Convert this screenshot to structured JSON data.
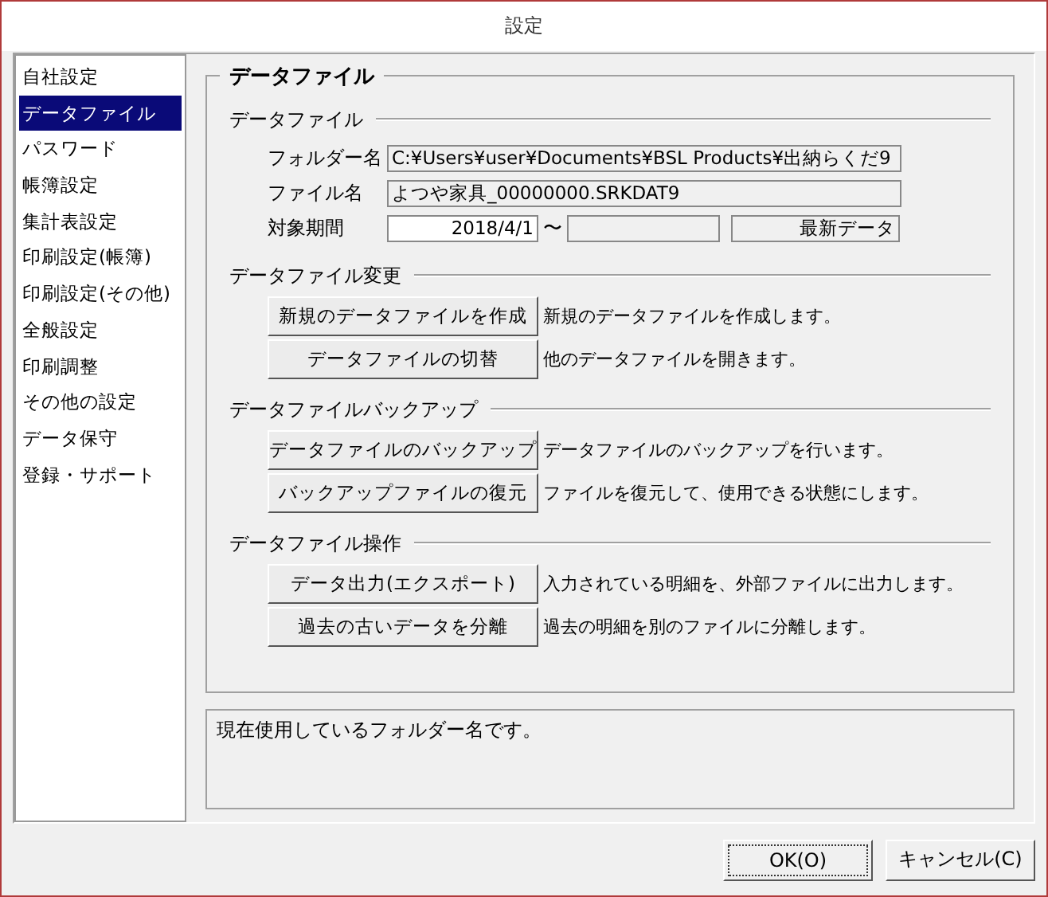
{
  "window": {
    "title": "設定"
  },
  "sidebar": {
    "items": [
      {
        "label": "自社設定",
        "selected": false
      },
      {
        "label": "データファイル",
        "selected": true
      },
      {
        "label": "パスワード",
        "selected": false
      },
      {
        "label": "帳簿設定",
        "selected": false
      },
      {
        "label": "集計表設定",
        "selected": false
      },
      {
        "label": "印刷設定(帳簿)",
        "selected": false
      },
      {
        "label": "印刷設定(その他)",
        "selected": false
      },
      {
        "label": "全般設定",
        "selected": false
      },
      {
        "label": "印刷調整",
        "selected": false
      },
      {
        "label": "その他の設定",
        "selected": false
      },
      {
        "label": "データ保守",
        "selected": false
      },
      {
        "label": "登録・サポート",
        "selected": false
      }
    ]
  },
  "panel": {
    "title": "データファイル",
    "sections": [
      {
        "kind": "fields",
        "title": "データファイル",
        "folder": {
          "label": "フォルダー名",
          "value": "C:¥Users¥user¥Documents¥BSL Products¥出納らくだ9"
        },
        "file": {
          "label": "ファイル名",
          "value": "よつや家具_00000000.SRKDAT9"
        },
        "period": {
          "label": "対象期間",
          "from": "2018/4/1",
          "separator": "〜",
          "latest": "最新データ"
        }
      },
      {
        "kind": "actions",
        "title": "データファイル変更",
        "actions": [
          {
            "button": "新規のデータファイルを作成",
            "description": "新規のデータファイルを作成します。"
          },
          {
            "button": "データファイルの切替",
            "description": "他のデータファイルを開きます。"
          }
        ]
      },
      {
        "kind": "actions",
        "title": "データファイルバックアップ",
        "actions": [
          {
            "button": "データファイルのバックアップ",
            "description": "データファイルのバックアップを行います。"
          },
          {
            "button": "バックアップファイルの復元",
            "description": "ファイルを復元して、使用できる状態にします。"
          }
        ]
      },
      {
        "kind": "actions",
        "title": "データファイル操作",
        "actions": [
          {
            "button": "データ出力(エクスポート)",
            "description": "入力されている明細を、外部ファイルに出力します。"
          },
          {
            "button": "過去の古いデータを分離",
            "description": "過去の明細を別のファイルに分離します。"
          }
        ]
      }
    ]
  },
  "help_text": "現在使用しているフォルダー名です。",
  "buttons": [
    {
      "label": "OK(O)",
      "focused": true
    },
    {
      "label": "キャンセル(C)",
      "focused": false
    }
  ]
}
